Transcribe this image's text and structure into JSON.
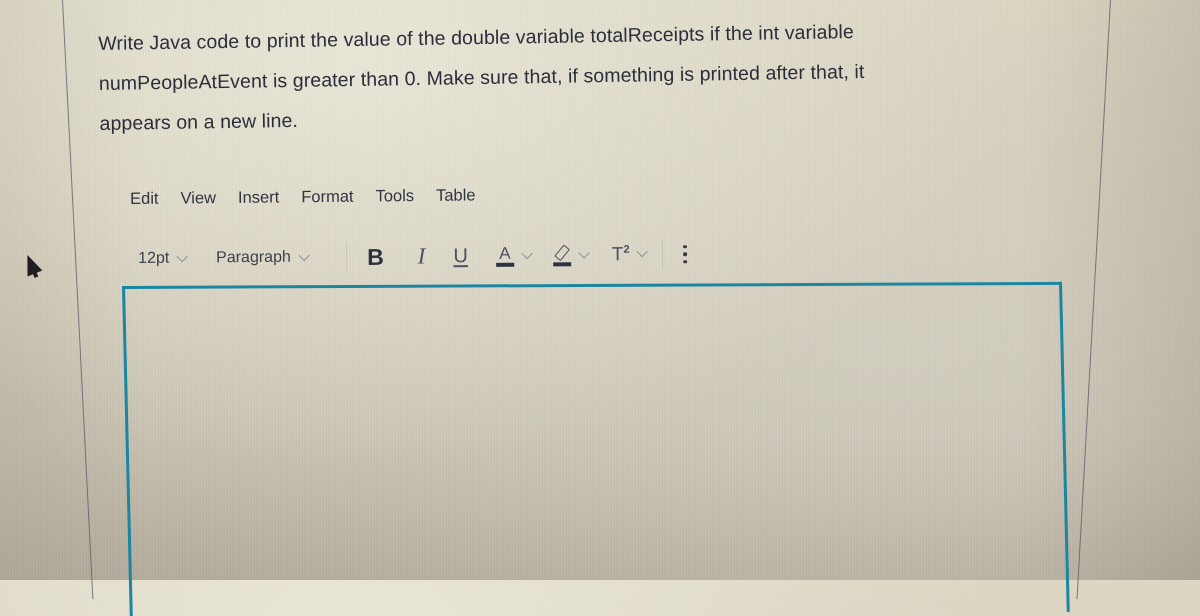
{
  "question": {
    "lines": [
      "Write Java code to print the value of the double variable totalReceipts if the int variable",
      "numPeopleAtEvent is greater than 0.  Make sure that, if something is printed after that, it",
      "appears on a new line."
    ]
  },
  "menubar": {
    "items": [
      {
        "label": "Edit"
      },
      {
        "label": "View"
      },
      {
        "label": "Insert"
      },
      {
        "label": "Format"
      },
      {
        "label": "Tools"
      },
      {
        "label": "Table"
      }
    ]
  },
  "toolbar": {
    "font_size": "12pt",
    "block_format": "Paragraph",
    "bold_label": "B",
    "italic_label": "I",
    "underline_label": "U",
    "text_color_label": "A",
    "superscript_base": "T",
    "superscript_exp": "2",
    "icons": {
      "font_size_dropdown": "chevron-down-icon",
      "block_format_dropdown": "chevron-down-icon",
      "bold": "bold-icon",
      "italic": "italic-icon",
      "underline": "underline-icon",
      "text_color": "text-color-icon",
      "highlight": "highlight-pen-icon",
      "superscript": "superscript-icon",
      "more": "more-vertical-icon"
    },
    "text_color_swatch": "#2c3340",
    "highlight_color_swatch": "#2c3340"
  },
  "editor": {
    "content": "",
    "border_color": "#1c86a0"
  }
}
